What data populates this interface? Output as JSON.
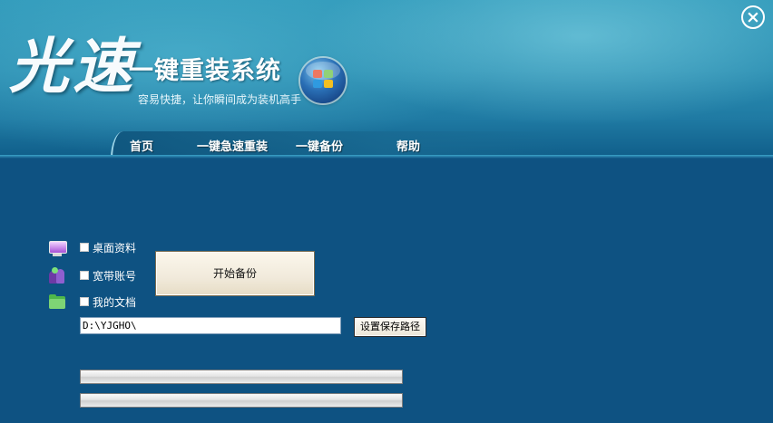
{
  "window": {
    "close_label": "⊗"
  },
  "brand": {
    "char1": "光",
    "char2": "速",
    "title": "一键重装系统",
    "slogan": "容易快捷，让你瞬间成为装机高手",
    "logo_icon": "windows-logo-icon"
  },
  "nav": {
    "items": [
      {
        "label": "首页"
      },
      {
        "label": "一键急速重装"
      },
      {
        "label": "一键备份"
      },
      {
        "label": "帮助"
      }
    ]
  },
  "backup": {
    "options": [
      {
        "label": "桌面资料",
        "checked": false,
        "icon": "monitor-icon"
      },
      {
        "label": "宽带账号",
        "checked": false,
        "icon": "users-icon"
      },
      {
        "label": "我的文档",
        "checked": false,
        "icon": "folder-icon"
      }
    ],
    "start_label": "开始备份",
    "path_value": "D:\\YJGHO\\",
    "set_path_label": "设置保存路径",
    "progress": [
      0,
      0
    ]
  },
  "colors": {
    "background": "#0e5282",
    "header": "#2a8db1",
    "text": "#ffffff"
  }
}
